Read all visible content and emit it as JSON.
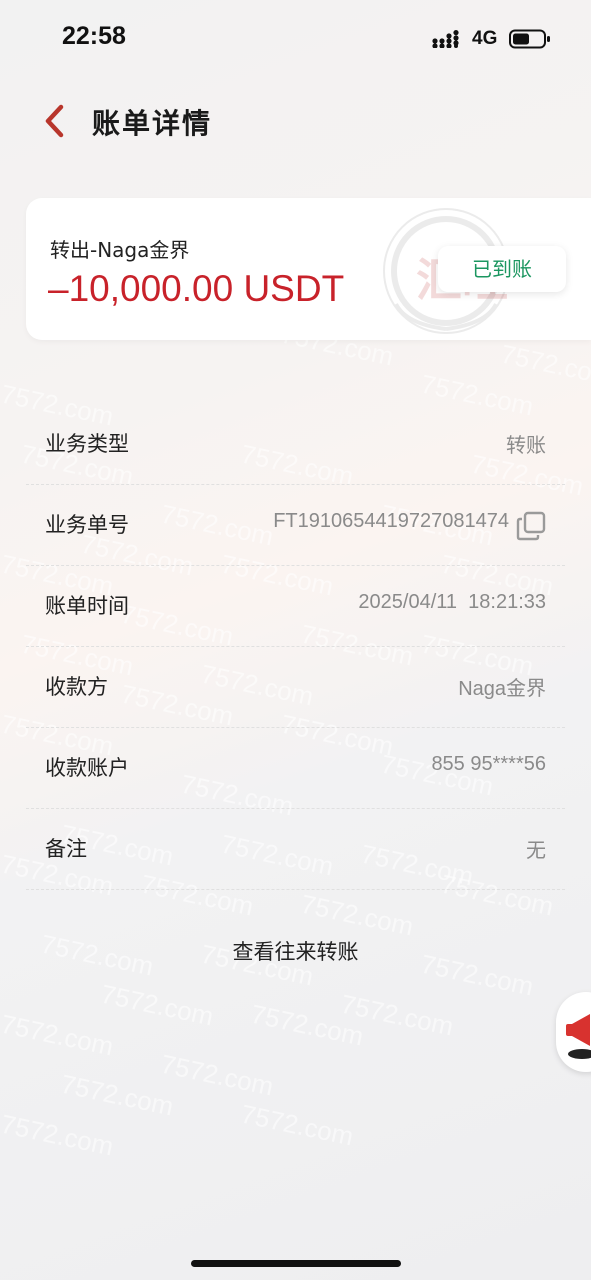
{
  "status_bar": {
    "time": "22:58",
    "network": "4G",
    "battery_level": 0.55
  },
  "nav": {
    "title": "账单详情",
    "back_icon": "chevron-left-icon"
  },
  "summary": {
    "title": "转出-Naga金界",
    "amount": "–10,000.00 USDT",
    "status": "已到账",
    "seal_text": "汇旺",
    "colors": {
      "amount": "#c8222a",
      "status": "#1b9660",
      "back": "#b8362c"
    }
  },
  "details": [
    {
      "label": "业务类型",
      "value": "转账"
    },
    {
      "label": "业务单号",
      "value": "FT1910654419727081474",
      "icon": "copy-icon"
    },
    {
      "label": "账单时间",
      "value": "2025/04/11  18:21:33"
    },
    {
      "label": "收款方",
      "value": "Naga金界"
    },
    {
      "label": "收款账户",
      "value": "855 95****56"
    },
    {
      "label": "备注",
      "value": "无"
    }
  ],
  "view_link": "查看往来转账",
  "watermark": "7572.com"
}
